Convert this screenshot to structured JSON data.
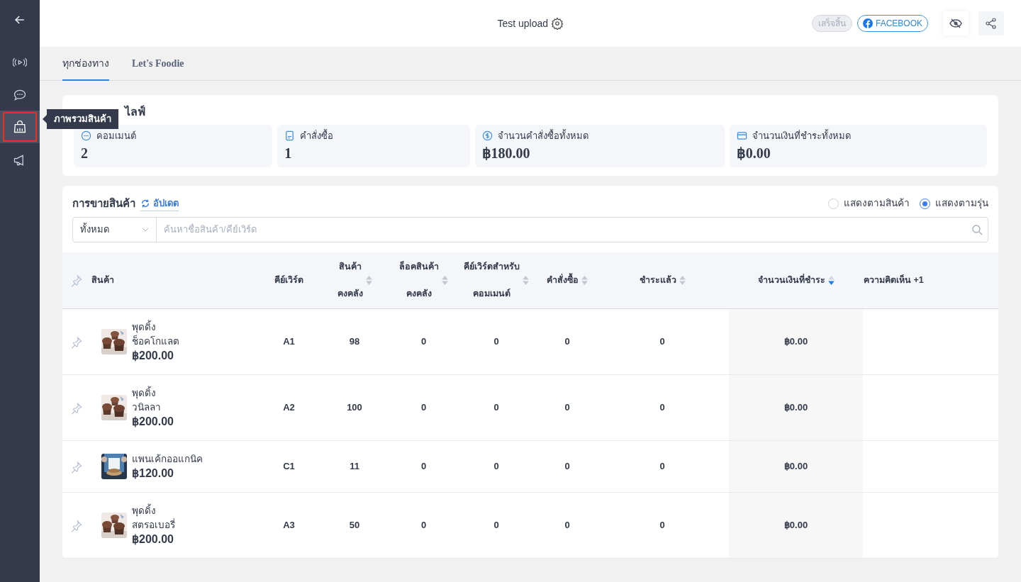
{
  "sidebar": {
    "items": [
      {
        "selected": false
      },
      {
        "selected": false
      },
      {
        "selected": false
      },
      {
        "selected": true
      },
      {
        "selected": false
      }
    ],
    "tooltip": "ภาพรวมสินค้า"
  },
  "header": {
    "title": "Test upload",
    "status": "เสร็จสิ้น",
    "platform": "FACEBOOK"
  },
  "tabs": [
    {
      "label": "ทุกช่องทาง",
      "selected": true
    },
    {
      "label": "Let's Foodie",
      "selected": false
    }
  ],
  "summary": {
    "title": "ไลฟ์",
    "stats": [
      {
        "label": "คอมเมนต์",
        "value": "2"
      },
      {
        "label": "คำสั่งซื้อ",
        "value": "1"
      },
      {
        "label": "จำนวนคำสั่งซื้อทั้งหมด",
        "value": "฿180.00"
      },
      {
        "label": "จำนวนเงินที่ชำระทั้งหมด",
        "value": "฿0.00"
      }
    ]
  },
  "sales": {
    "title": "การขายสินค้า",
    "update": "อัปเดต",
    "views": [
      {
        "label": "แสดงตามสินค้า",
        "selected": false
      },
      {
        "label": "แสดงตามรุ่น",
        "selected": true
      }
    ],
    "filter": "ทั้งหมด",
    "search_placeholder": "ค้นหาชื่อสินค้า/คีย์เวิร์ด",
    "columns": [
      {
        "label": "สินค้า"
      },
      {
        "label": "คีย์เวิร์ด"
      },
      {
        "lines": [
          "สินค้า",
          "คงคลัง"
        ],
        "sorted": false
      },
      {
        "lines": [
          "ล็อคสินค้า",
          "คงคลัง"
        ],
        "sorted": false
      },
      {
        "lines": [
          "คีย์เวิร์ดสำหรับ",
          "คอมเมนต์"
        ],
        "sorted": false
      },
      {
        "label": "คำสั่งซื้อ",
        "sorted": false
      },
      {
        "label": "ชำระแล้ว",
        "sorted": false
      },
      {
        "label": "จำนวนเงินที่ชำระ",
        "sorted": true
      },
      {
        "label": "ความคิดเห็น +1"
      }
    ],
    "rows": [
      {
        "pinned": false,
        "name": [
          "พุดดิ้ง",
          "ช็อคโกแลต"
        ],
        "price": "฿200.00",
        "keyword": "A1",
        "stock": "98",
        "locked": "0",
        "kw_comments": "0",
        "orders": "0",
        "paid": "0",
        "amount": "฿0.00"
      },
      {
        "pinned": false,
        "name": [
          "พุดดิ้ง",
          "วนิลลา"
        ],
        "price": "฿200.00",
        "keyword": "A2",
        "stock": "100",
        "locked": "0",
        "kw_comments": "0",
        "orders": "0",
        "paid": "0",
        "amount": "฿0.00"
      },
      {
        "pinned": false,
        "name": [
          "แพนเค้กออแกนิค"
        ],
        "price": "฿120.00",
        "keyword": "C1",
        "stock": "11",
        "locked": "0",
        "kw_comments": "0",
        "orders": "0",
        "paid": "0",
        "amount": "฿0.00"
      },
      {
        "pinned": false,
        "name": [
          "พุดดิ้ง",
          "สตรอเบอรี่"
        ],
        "price": "฿200.00",
        "keyword": "A3",
        "stock": "50",
        "locked": "0",
        "kw_comments": "0",
        "orders": "0",
        "paid": "0",
        "amount": "฿0.00"
      }
    ]
  }
}
